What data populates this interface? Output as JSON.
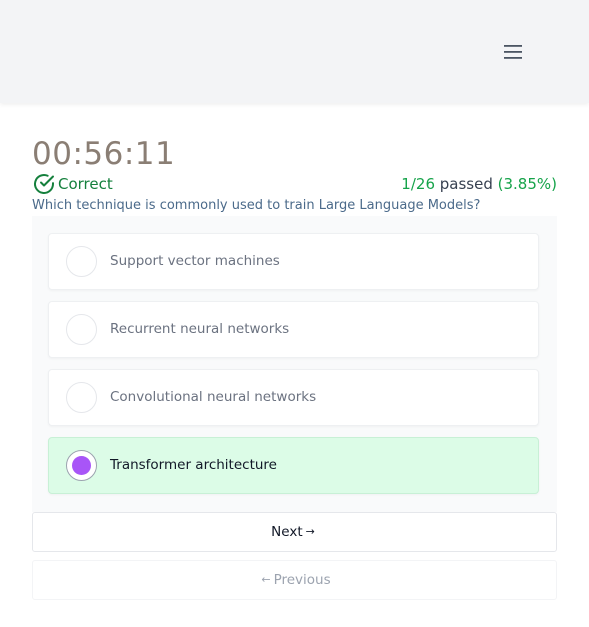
{
  "header": {
    "menu_icon": "hamburger-menu-icon"
  },
  "quiz": {
    "timer": "00:56:11",
    "result_label": "Correct",
    "result_icon": "check-circle-icon",
    "progress_count": "1/26",
    "progress_word": "passed",
    "progress_pct": "(3.85%)",
    "question": "Which technique is commonly used to train Large Language Models?",
    "options": [
      {
        "label": "Support vector machines",
        "selected": false
      },
      {
        "label": "Recurrent neural networks",
        "selected": false
      },
      {
        "label": "Convolutional neural networks",
        "selected": false
      },
      {
        "label": "Transformer architecture",
        "selected": true
      }
    ],
    "next_label": "Next",
    "next_arrow": "→",
    "prev_label": "Previous",
    "prev_arrow": "←"
  },
  "colors": {
    "correct": "#15803d",
    "selected_bg": "#dcfce7",
    "radio_fill": "#a855f7",
    "timer": "#8a7e74"
  }
}
